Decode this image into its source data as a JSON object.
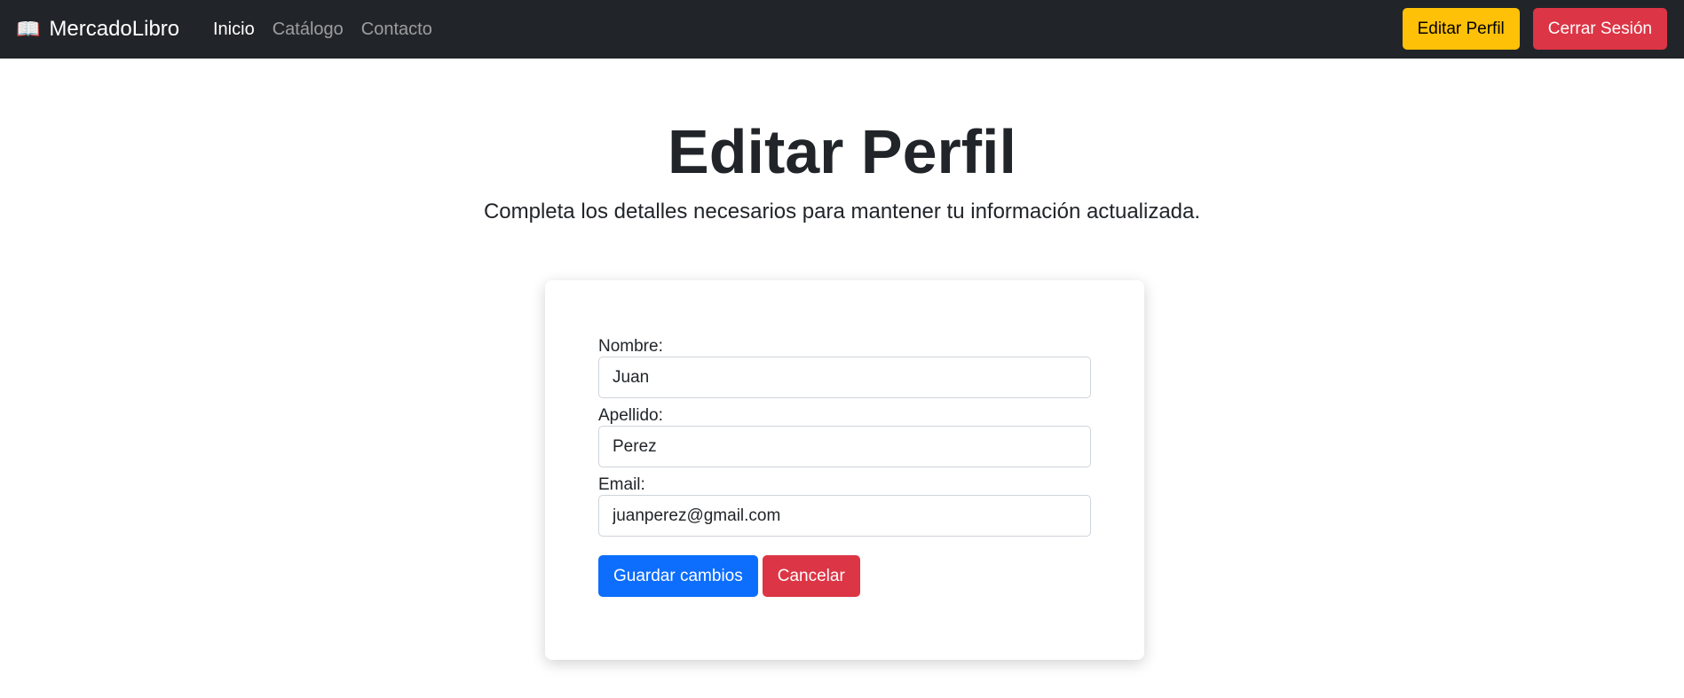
{
  "navbar": {
    "brand_icon": "📖",
    "brand_label": "MercadoLibro",
    "links": [
      {
        "label": "Inicio"
      },
      {
        "label": "Catálogo"
      },
      {
        "label": "Contacto"
      }
    ],
    "edit_profile_label": "Editar Perfil",
    "logout_label": "Cerrar Sesión"
  },
  "page": {
    "title": "Editar Perfil",
    "subtitle": "Completa los detalles necesarios para mantener tu información actualizada."
  },
  "form": {
    "first_name": {
      "label": "Nombre:",
      "value": "Juan"
    },
    "last_name": {
      "label": "Apellido:",
      "value": "Perez"
    },
    "email": {
      "label": "Email:",
      "value": "juanperez@gmail.com"
    },
    "save_label": "Guardar cambios",
    "cancel_label": "Cancelar"
  },
  "colors": {
    "navbar_bg": "#212529",
    "warning": "#ffc107",
    "danger": "#dc3545",
    "primary": "#0d6efd"
  }
}
